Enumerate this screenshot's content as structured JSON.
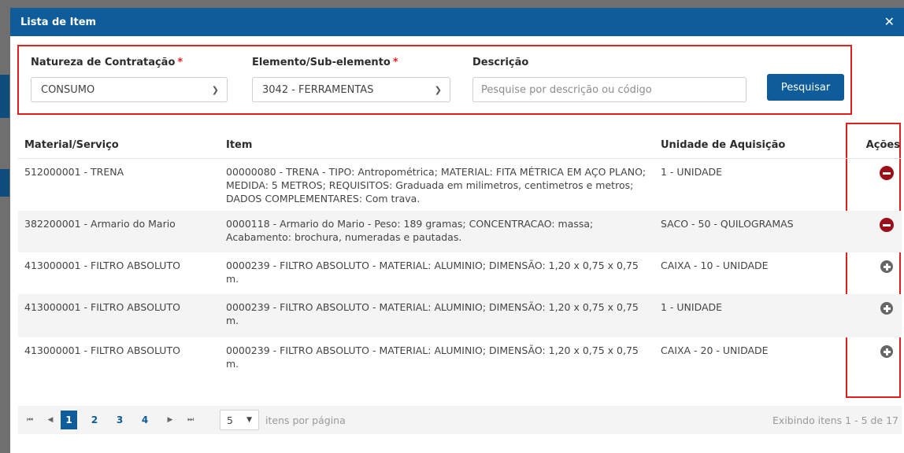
{
  "modal": {
    "title": "Lista de Item",
    "close_symbol": "✕"
  },
  "filters": {
    "natureza": {
      "label": "Natureza de Contratação",
      "required_mark": "*",
      "value": "CONSUMO"
    },
    "elemento": {
      "label": "Elemento/Sub-elemento",
      "required_mark": "*",
      "value": "3042 - FERRAMENTAS"
    },
    "descricao": {
      "label": "Descrição",
      "placeholder": "Pesquise por descrição ou código"
    },
    "search_button": "Pesquisar"
  },
  "table": {
    "headers": [
      "Material/Serviço",
      "Item",
      "Unidade de Aquisição",
      "Ações"
    ],
    "rows": [
      {
        "material": "512000001 - TRENA",
        "item": "00000080 - TRENA - TIPO: Antropométrica; MATERIAL: FITA MÉTRICA EM AÇO PLANO; MEDIDA: 5 METROS; REQUISITOS: Graduada em milimetros, centimetros e metros; DADOS COMPLEMENTARES: Com trava.",
        "unidade": "1 - UNIDADE",
        "action": "remove"
      },
      {
        "material": "382200001 - Armario do Mario",
        "item": "0000118 - Armario do Mario - Peso: 189 gramas; CONCENTRACAO: massa; Acabamento: brochura, numeradas e pautadas.",
        "unidade": "SACO - 50 - QUILOGRAMAS",
        "action": "remove"
      },
      {
        "material": "413000001 - FILTRO ABSOLUTO",
        "item": "0000239 - FILTRO ABSOLUTO - MATERIAL: ALUMINIO; DIMENSÃO: 1,20 x 0,75 x 0,75 m.",
        "unidade": "CAIXA - 10 - UNIDADE",
        "action": "add"
      },
      {
        "material": "413000001 - FILTRO ABSOLUTO",
        "item": "0000239 - FILTRO ABSOLUTO - MATERIAL: ALUMINIO; DIMENSÃO: 1,20 x 0,75 x 0,75 m.",
        "unidade": "1 - UNIDADE",
        "action": "add"
      },
      {
        "material": "413000001 - FILTRO ABSOLUTO",
        "item": "0000239 - FILTRO ABSOLUTO - MATERIAL: ALUMINIO; DIMENSÃO: 1,20 x 0,75 x 0,75 m.",
        "unidade": "CAIXA - 20 - UNIDADE",
        "action": "add"
      }
    ]
  },
  "pager": {
    "first": "⏮",
    "prev": "◀",
    "next": "▶",
    "last": "⏭",
    "pages": [
      "1",
      "2",
      "3",
      "4"
    ],
    "current_page": "1",
    "page_size": "5",
    "page_size_label": "itens por página",
    "info": "Exibindo itens 1 - 5 de 17"
  },
  "colors": {
    "header_bg": "#0e5c99",
    "highlight_border": "#e32020",
    "remove_icon": "#9b0f19",
    "add_icon": "#666666"
  }
}
